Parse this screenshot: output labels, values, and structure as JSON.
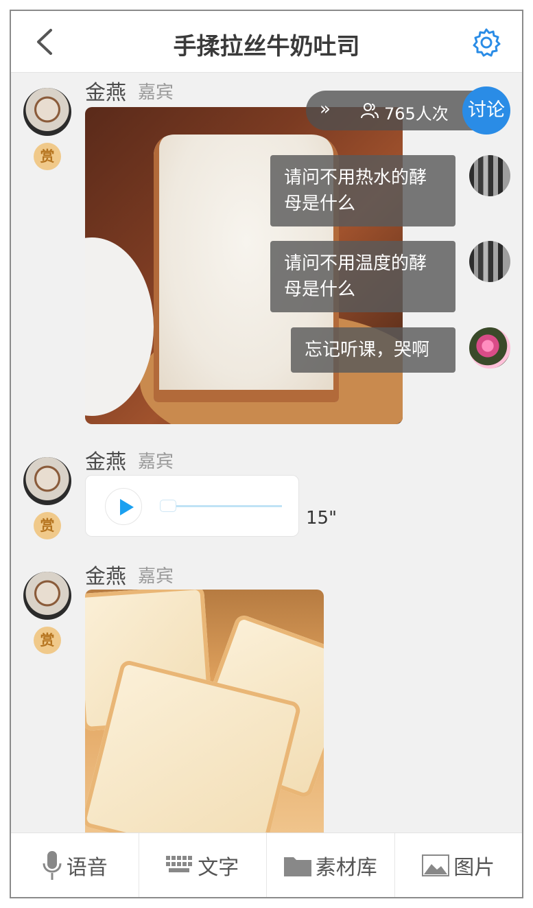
{
  "header": {
    "title": "手揉拉丝牛奶吐司",
    "back_icon": "chevron-left-icon",
    "settings_icon": "gear-icon"
  },
  "messages": [
    {
      "author": "金燕",
      "role": "嘉宾",
      "reward": "赏",
      "type": "image"
    },
    {
      "author": "金燕",
      "role": "嘉宾",
      "reward": "赏",
      "type": "audio",
      "duration": "15\""
    },
    {
      "author": "金燕",
      "role": "嘉宾",
      "reward": "赏",
      "type": "image"
    }
  ],
  "overlay": {
    "viewers": "765人次",
    "collapse": "»",
    "discuss_label": "讨论",
    "comments": [
      {
        "text": "请问不用热水的酵母是什么"
      },
      {
        "text": "请问不用温度的酵母是什么"
      },
      {
        "text": "忘记听课，哭啊"
      }
    ]
  },
  "toolbar": {
    "voice": "语音",
    "text": "文字",
    "library": "素材库",
    "picture": "图片"
  }
}
